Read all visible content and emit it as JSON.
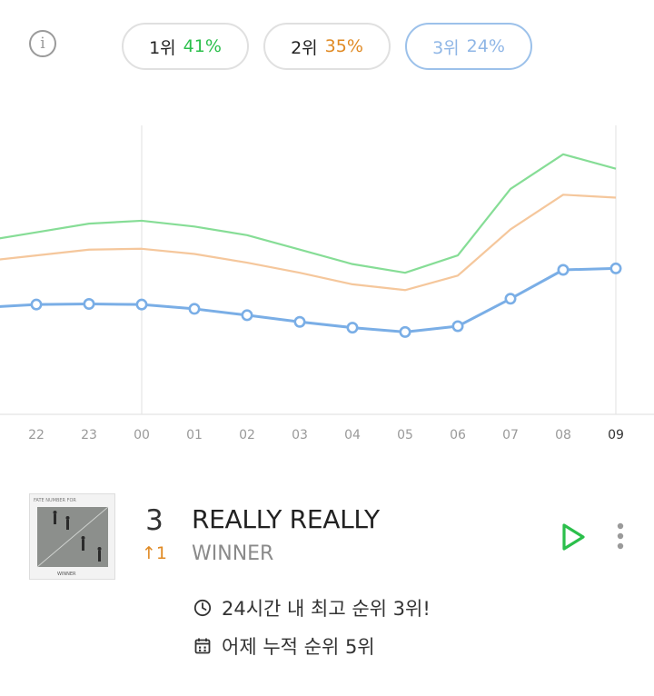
{
  "header": {
    "info_icon": "i",
    "pills": [
      {
        "label": "1위",
        "value": "41%",
        "color": "#2bbf4b",
        "active": false
      },
      {
        "label": "2위",
        "value": "35%",
        "color": "#e08a24",
        "active": false
      },
      {
        "label": "3위",
        "value": "24%",
        "color": "#8fb6e6",
        "active": true
      }
    ]
  },
  "chart_data": {
    "type": "line",
    "x": [
      "",
      "22",
      "23",
      "00",
      "01",
      "02",
      "03",
      "04",
      "05",
      "06",
      "07",
      "08",
      "09"
    ],
    "highlight_x": "09",
    "ylim": [
      0,
      100
    ],
    "grid": false,
    "series": [
      {
        "values": [
          60,
          63,
          66,
          67,
          65,
          62,
          57,
          52,
          49,
          55,
          78,
          90,
          85
        ],
        "color": "#86dd96",
        "markers": false
      },
      {
        "values": [
          53,
          55,
          57,
          57.3,
          55.5,
          52.5,
          49,
          45,
          43,
          48,
          64,
          76,
          75
        ],
        "color": "#f5c79c",
        "markers": false
      },
      {
        "values": [
          37,
          38,
          38.2,
          38,
          36.5,
          34.3,
          32,
          30,
          28.5,
          30.5,
          40,
          50,
          50.5
        ],
        "color": "#7aaee6",
        "markers": true
      }
    ]
  },
  "song": {
    "rank": "3",
    "change": "↑1",
    "title": "REALLY REALLY",
    "artist": "WINNER",
    "album_text": "FATE NUMBER FOR",
    "album_brand": "WINNER",
    "best_rank_text": "24시간 내 최고 순위 3위!",
    "yesterday_text": "어제 누적 순위 5위",
    "play_icon": "play-icon",
    "more_icon": "more-vertical-icon"
  }
}
